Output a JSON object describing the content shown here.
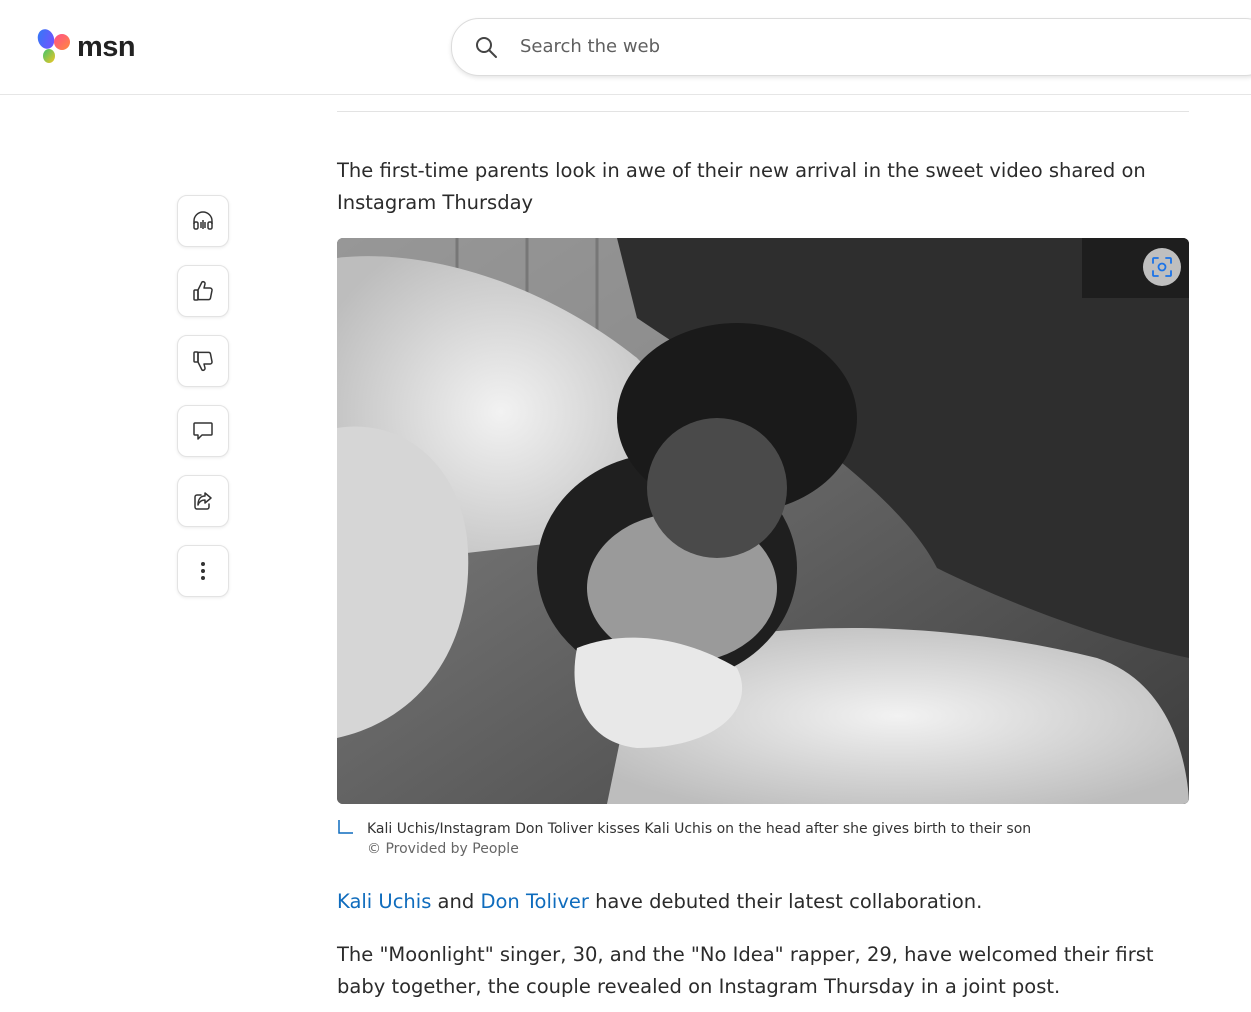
{
  "header": {
    "logo_text": "msn",
    "search_placeholder": "Search the web"
  },
  "rail": {
    "items": [
      {
        "name": "listen",
        "icon": "headphones-icon"
      },
      {
        "name": "like",
        "icon": "thumbs-up-icon"
      },
      {
        "name": "dislike",
        "icon": "thumbs-down-icon"
      },
      {
        "name": "comment",
        "icon": "comment-icon"
      },
      {
        "name": "share",
        "icon": "share-icon"
      },
      {
        "name": "more",
        "icon": "more-vertical-icon"
      }
    ]
  },
  "article": {
    "intro": "The first-time parents look in awe of their new arrival in the sweet video shared on Instagram Thursday",
    "image": {
      "caption": "Kali Uchis/Instagram Don Toliver kisses Kali Uchis on the head after she gives birth to their son",
      "credit": "© Provided by People"
    },
    "para1": {
      "link1": "Kali Uchis",
      "mid": " and ",
      "link2": "Don Toliver",
      "rest": " have debuted their latest collaboration."
    },
    "para2": "The \"Moonlight\" singer, 30, and the \"No Idea\" rapper, 29, have welcomed their first baby together, the couple revealed on Instagram Thursday in a joint post."
  },
  "colors": {
    "link": "#0f6cbd",
    "text": "#2b2b2b"
  }
}
